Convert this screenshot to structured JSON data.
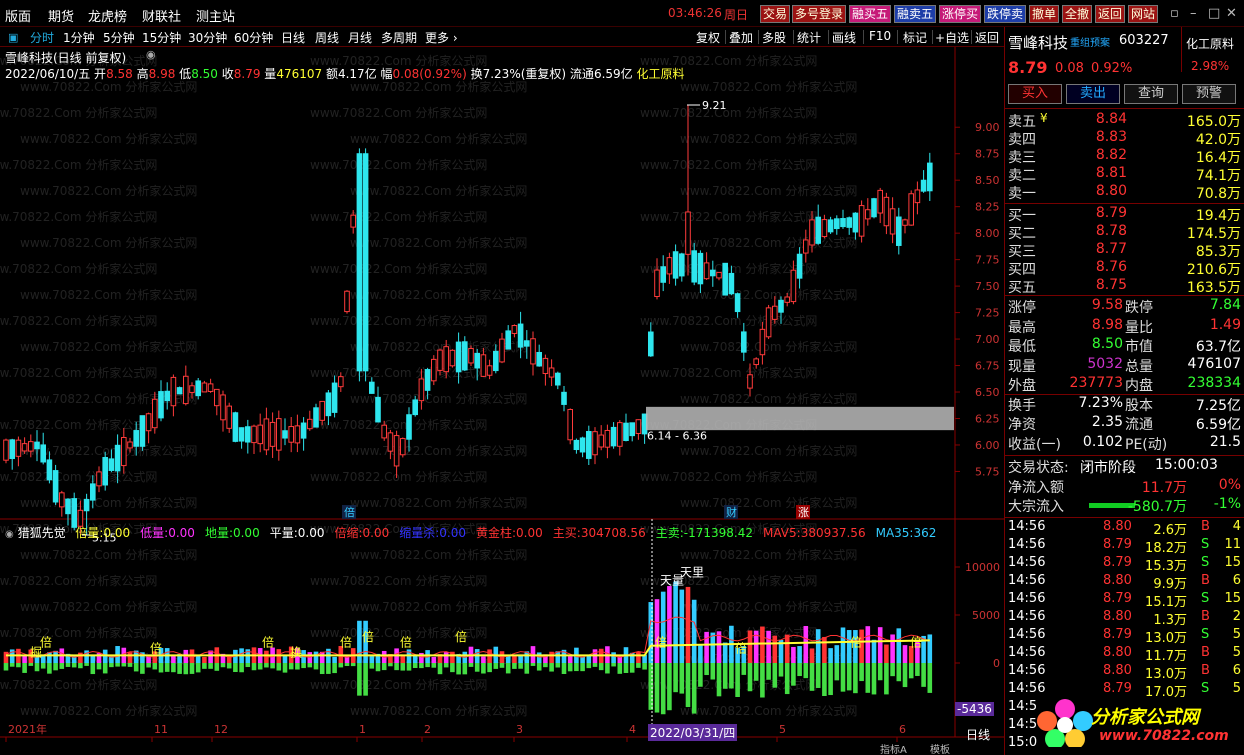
{
  "menubar": {
    "items": [
      "版面",
      "期货",
      "龙虎榜",
      "财联社",
      "测主站"
    ],
    "clock": "03:46:26",
    "weekday": "周日",
    "buttons": [
      "交易",
      "多号登录",
      "融买五",
      "融卖五",
      "涨停买",
      "跌停卖",
      "撤单",
      "全撤",
      "返回",
      "网站"
    ],
    "win_icons": [
      "▫",
      "–",
      "□",
      "✕"
    ]
  },
  "periods": [
    "分时",
    "1分钟",
    "5分钟",
    "15分钟",
    "30分钟",
    "60分钟",
    "日线",
    "周线",
    "月线",
    "多周期",
    "更多 ›"
  ],
  "active_period": "分时",
  "right_tools": [
    "复权",
    "叠加",
    "多股",
    "统计",
    "画线",
    "F10",
    "标记",
    "+自选",
    "返回"
  ],
  "stock": {
    "name": "雪峰科技",
    "code": "603227",
    "industry": "化工原料",
    "price": "8.79",
    "change": "0.08",
    "pct": "0.92%",
    "industry_pct": "2.98%",
    "group_label": "重组预案"
  },
  "info": {
    "title": "雪峰科技(日线 前复权)",
    "date": "2022/06/10/五",
    "open_label": "开",
    "open": "8.58",
    "high_label": "高",
    "high": "8.98",
    "low_label": "低",
    "low": "8.50",
    "close_label": "收",
    "close": "8.79",
    "vol_label": "量",
    "vol": "476107",
    "amt_label": "额",
    "amt": "4.17亿",
    "amp_label": "幅",
    "amp": "0.08(0.92%)",
    "turn_label": "换",
    "turn": "7.23%(重复权)",
    "float_label": "流通",
    "float": "6.59亿",
    "industry": "化工原料"
  },
  "watermark": "www.70822.Com 分析家公式网",
  "chart_data": {
    "type": "candlestick",
    "y_ticks": [
      "9.00",
      "8.75",
      "8.50",
      "8.25",
      "8.00",
      "7.75",
      "7.50",
      "7.25",
      "7.00",
      "6.75",
      "6.50",
      "6.25",
      "6.00",
      "5.75"
    ],
    "y_values": [
      9.0,
      8.75,
      8.5,
      8.25,
      8.0,
      7.75,
      7.5,
      7.25,
      7.0,
      6.75,
      6.5,
      6.25,
      6.0,
      5.75
    ],
    "annotations": [
      "9.21",
      "5.15",
      "6.14 - 6.36"
    ],
    "markers": [
      "倍",
      "财",
      "涨"
    ],
    "date_axis": [
      "2021年",
      "11",
      "12",
      "1",
      "2",
      "3",
      "4",
      "5",
      "6"
    ],
    "cursor_date": "2022/03/31/四",
    "x_end_label": "日线"
  },
  "indicator": {
    "name": "猎狐先觉",
    "items": [
      {
        "label": "倍量:",
        "value": "0.00",
        "color": "#ff3"
      },
      {
        "label": "低量:",
        "value": "0.00",
        "color": "#f3f"
      },
      {
        "label": "地量:",
        "value": "0.00",
        "color": "#3f3"
      },
      {
        "label": "平量:",
        "value": "0.00",
        "color": "#fff"
      },
      {
        "label": "倍缩:",
        "value": "0.00",
        "color": "#f33"
      },
      {
        "label": "缩量杀:",
        "value": "0.00",
        "color": "#33f"
      },
      {
        "label": "黄金柱:",
        "value": "0.00",
        "color": "#f33"
      },
      {
        "label": "主买:",
        "value": "304708.56",
        "color": "#f33"
      },
      {
        "label": "主卖:",
        "value": "-171398.42",
        "color": "#3f3"
      },
      {
        "label": "MAV5:",
        "value": "380937.56",
        "color": "#f33"
      },
      {
        "label": "MA35:",
        "value": "362",
        "color": "#3cf"
      }
    ],
    "y_ticks": [
      "10000",
      "5000",
      "0"
    ],
    "cursor_value": "-5436",
    "tags": [
      "倍",
      "天量",
      "天里",
      "掘",
      "换"
    ]
  },
  "bottom_tabs": [
    "指标A",
    "模板"
  ],
  "orderbook": {
    "sell": [
      {
        "label": "卖五",
        "price": "8.84",
        "vol": "165.0万"
      },
      {
        "label": "卖四",
        "price": "8.83",
        "vol": "42.0万"
      },
      {
        "label": "卖三",
        "price": "8.82",
        "vol": "16.4万"
      },
      {
        "label": "卖二",
        "price": "8.81",
        "vol": "74.1万"
      },
      {
        "label": "卖一",
        "price": "8.80",
        "vol": "70.8万"
      }
    ],
    "buy": [
      {
        "label": "买一",
        "price": "8.79",
        "vol": "19.4万"
      },
      {
        "label": "买二",
        "price": "8.78",
        "vol": "174.5万"
      },
      {
        "label": "买三",
        "price": "8.77",
        "vol": "85.3万"
      },
      {
        "label": "买四",
        "price": "8.76",
        "vol": "210.6万"
      },
      {
        "label": "买五",
        "price": "8.75",
        "vol": "163.5万"
      }
    ],
    "sell5_mark": "¥"
  },
  "actions": [
    "买入",
    "卖出",
    "查询",
    "预警"
  ],
  "stats": [
    {
      "l1": "涨停",
      "v1": "9.58",
      "c1": "#f33",
      "l2": "跌停",
      "v2": "7.84",
      "c2": "#3f3"
    },
    {
      "l1": "最高",
      "v1": "8.98",
      "c1": "#f33",
      "l2": "量比",
      "v2": "1.49",
      "c2": "#f33"
    },
    {
      "l1": "最低",
      "v1": "8.50",
      "c1": "#3f3",
      "l2": "市值",
      "v2": "63.7亿",
      "c2": "#fff"
    },
    {
      "l1": "现量",
      "v1": "5032",
      "c1": "#c3c",
      "l2": "总量",
      "v2": "476107",
      "c2": "#fff"
    },
    {
      "l1": "外盘",
      "v1": "237773",
      "c1": "#f33",
      "l2": "内盘",
      "v2": "238334",
      "c2": "#3f3"
    },
    {
      "l1": "换手",
      "v1": "7.23%",
      "c1": "#fff",
      "l2": "股本",
      "v2": "7.25亿",
      "c2": "#fff"
    },
    {
      "l1": "净资",
      "v1": "2.35",
      "c1": "#fff",
      "l2": "流通",
      "v2": "6.59亿",
      "c2": "#fff"
    },
    {
      "l1": "收益(一)",
      "v1": "0.102",
      "c1": "#fff",
      "l2": "PE(动)",
      "v2": "21.5",
      "c2": "#fff"
    }
  ],
  "trade_status": {
    "label": "交易状态:",
    "value": "闭市阶段",
    "time": "15:00:03"
  },
  "flows": [
    {
      "label": "净流入额",
      "value": "11.7万",
      "pct": "0%",
      "c": "#f33"
    },
    {
      "label": "大宗流入",
      "value": "-580.7万",
      "pct": "-1%",
      "c": "#3f3"
    }
  ],
  "ticks": [
    {
      "t": "14:56",
      "p": "8.80",
      "v": "2.6万",
      "d": "B",
      "n": "4"
    },
    {
      "t": "14:56",
      "p": "8.79",
      "v": "18.2万",
      "d": "S",
      "n": "11"
    },
    {
      "t": "14:56",
      "p": "8.79",
      "v": "15.3万",
      "d": "S",
      "n": "15"
    },
    {
      "t": "14:56",
      "p": "8.80",
      "v": "9.9万",
      "d": "B",
      "n": "6"
    },
    {
      "t": "14:56",
      "p": "8.79",
      "v": "15.1万",
      "d": "S",
      "n": "15"
    },
    {
      "t": "14:56",
      "p": "8.80",
      "v": "1.3万",
      "d": "B",
      "n": "2"
    },
    {
      "t": "14:56",
      "p": "8.79",
      "v": "13.0万",
      "d": "S",
      "n": "5"
    },
    {
      "t": "14:56",
      "p": "8.80",
      "v": "11.7万",
      "d": "B",
      "n": "5"
    },
    {
      "t": "14:56",
      "p": "8.80",
      "v": "13.0万",
      "d": "B",
      "n": "6"
    },
    {
      "t": "14:56",
      "p": "8.79",
      "v": "17.0万",
      "d": "S",
      "n": "5"
    },
    {
      "t": "14:5",
      "p": "",
      "v": "",
      "d": "",
      "n": ""
    },
    {
      "t": "14:5",
      "p": "",
      "v": "",
      "d": "",
      "n": ""
    },
    {
      "t": "15:0",
      "p": "",
      "v": "",
      "d": "",
      "n": ""
    }
  ],
  "logo": {
    "text": "分析家公式网",
    "url": "www.70822.com"
  }
}
